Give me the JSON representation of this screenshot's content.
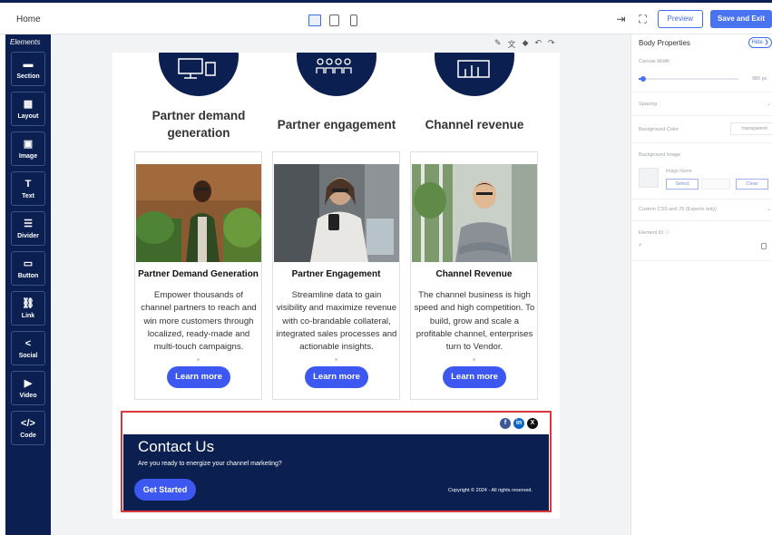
{
  "topbar": {
    "home": "Home",
    "device_icons": [
      "desktop-icon",
      "tablet-icon",
      "mobile-icon"
    ],
    "preview_label": "Preview",
    "save_label": "Save and Exit"
  },
  "sidebar": {
    "title": "Elements",
    "items": [
      {
        "label": "Section",
        "icon": "section-icon",
        "glyph": "▬"
      },
      {
        "label": "Layout",
        "icon": "layout-icon",
        "glyph": "▦"
      },
      {
        "label": "Image",
        "icon": "image-icon",
        "glyph": "▣"
      },
      {
        "label": "Text",
        "icon": "text-icon",
        "glyph": "T"
      },
      {
        "label": "Divider",
        "icon": "divider-icon",
        "glyph": "☰"
      },
      {
        "label": "Button",
        "icon": "button-icon",
        "glyph": "▭"
      },
      {
        "label": "Link",
        "icon": "link-icon",
        "glyph": "⛓"
      },
      {
        "label": "Social",
        "icon": "share-icon",
        "glyph": "<"
      },
      {
        "label": "Video",
        "icon": "video-icon",
        "glyph": "▶"
      },
      {
        "label": "Code",
        "icon": "code-icon",
        "glyph": "</>"
      }
    ]
  },
  "edit_tools": [
    "✎",
    "文",
    "◆",
    "↶",
    "↷"
  ],
  "categories": [
    {
      "title": "Partner demand generation",
      "icon": "monitor-icon"
    },
    {
      "title": "Partner engagement",
      "icon": "people-icon"
    },
    {
      "title": "Channel revenue",
      "icon": "chart-icon"
    }
  ],
  "cards": [
    {
      "title": "Partner Demand Generation",
      "text": "Empower thousands of channel partners to reach and win more customers through localized, ready-made and multi-touch campaigns.",
      "button": "Learn more"
    },
    {
      "title": "Partner Engagement",
      "text": "Streamline data to gain visibility and maximize revenue with co-brandable collateral, integrated sales processes and actionable insights.",
      "button": "Learn more"
    },
    {
      "title": "Channel Revenue",
      "text": "The channel business is high speed and high competition. To build, grow and scale a profitable channel, enterprises turn to Vendor.",
      "button": "Learn more"
    }
  ],
  "footer": {
    "social": [
      "f",
      "in",
      "X"
    ],
    "heading": "Contact Us",
    "subtext": "Are you ready to energize your channel marketing?",
    "cta": "Get Started",
    "copyright": "Copyright © 2024 - All rights reserved."
  },
  "panel": {
    "title": "Body Properties",
    "hide": "Hide ❯",
    "canvas_width_label": "Canvas Width",
    "canvas_width_value": "980 px",
    "spacing_label": "Spacing",
    "bg_color_label": "Background Color",
    "bg_color_value": "transparent",
    "bg_image_label": "Background Image",
    "image_name": "Image Name",
    "select_label": "Select",
    "clear_label": "Clear",
    "custom_css_label": "Custom CSS and JS (Experts only)",
    "element_id_label": "Element ID ⓘ",
    "element_id_value": "#"
  },
  "colors": {
    "navy": "#0b2050",
    "accent": "#3c58f0",
    "selection": "#d9393d"
  }
}
